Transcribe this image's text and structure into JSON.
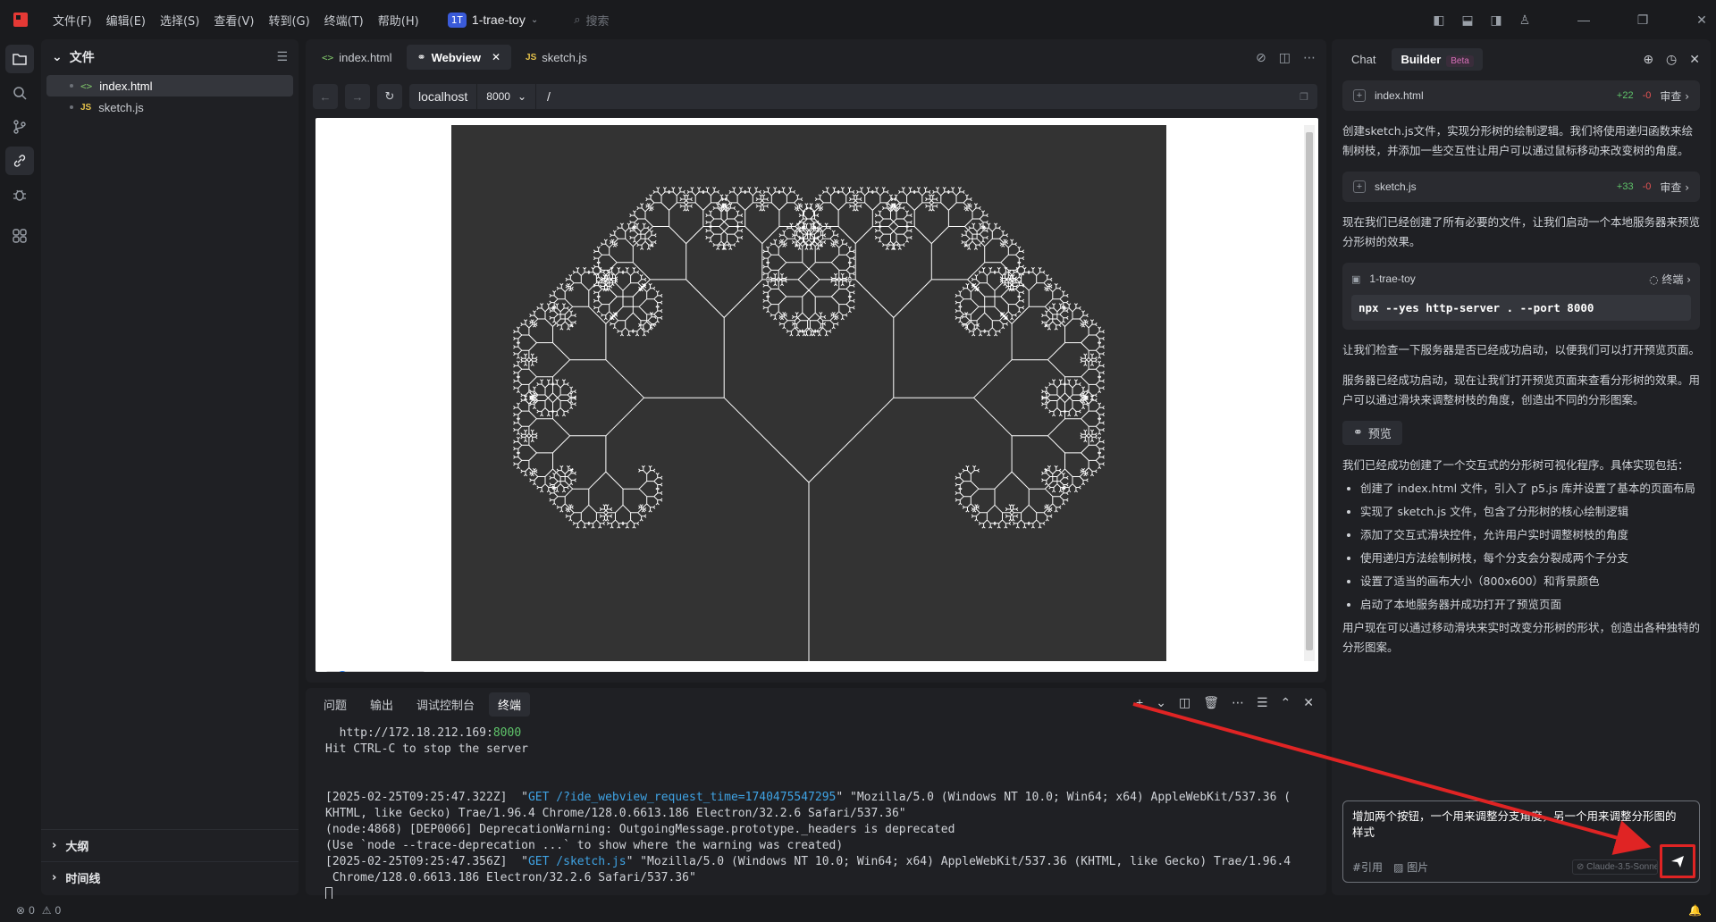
{
  "titlebar": {
    "menu": [
      "文件(F)",
      "编辑(E)",
      "选择(S)",
      "查看(V)",
      "转到(G)",
      "终端(T)",
      "帮助(H)"
    ],
    "project_badge": "1T",
    "project_name": "1-trae-toy",
    "search_placeholder": "搜索"
  },
  "sidebar": {
    "title": "文件",
    "files": [
      {
        "name": "index.html",
        "icon": "html-icon"
      },
      {
        "name": "sketch.js",
        "icon": "js-icon"
      }
    ],
    "outline": "大纲",
    "timeline": "时间线"
  },
  "editor": {
    "tabs": [
      {
        "label": "index.html",
        "icon": "html-icon"
      },
      {
        "label": "Webview",
        "icon": "link-icon",
        "active": true
      },
      {
        "label": "sketch.js",
        "icon": "js-icon"
      }
    ],
    "url": {
      "host": "localhost",
      "port": "8000",
      "path": "/"
    }
  },
  "panel": {
    "tabs": [
      "问题",
      "输出",
      "调试控制台",
      "终端"
    ],
    "active_tab": "终端",
    "terminal": {
      "l1a": "  http://172.18.212.169:",
      "l1b": "8000",
      "l2": "Hit CTRL-C to stop the server",
      "l3a": "[2025-02-25T09:25:47.322Z]  \"",
      "l3b": "GET /?ide_webview_request_time=1740475547295",
      "l3c": "\" \"Mozilla/5.0 (Windows NT 10.0; Win64; x64) AppleWebKit/537.36 (",
      "l4": "KHTML, like Gecko) Trae/1.96.4 Chrome/128.0.6613.186 Electron/32.2.6 Safari/537.36\"",
      "l5": "(node:4868) [DEP0066] DeprecationWarning: OutgoingMessage.prototype._headers is deprecated",
      "l6": "(Use `node --trace-deprecation ...` to show where the warning was created)",
      "l7a": "[2025-02-25T09:25:47.356Z]  \"",
      "l7b": "GET /sketch.js",
      "l7c": "\" \"Mozilla/5.0 (Windows NT 10.0; Win64; x64) AppleWebKit/537.36 (KHTML, like Gecko) Trae/1.96.4",
      "l8": " Chrome/128.0.6613.186 Electron/32.2.6 Safari/537.36\""
    }
  },
  "chat": {
    "tabs": {
      "chat": "Chat",
      "builder": "Builder",
      "beta": "Beta"
    },
    "card1": {
      "file": "index.html",
      "plus": "+22",
      "minus": "-0",
      "review": "审查"
    },
    "msg1": "创建sketch.js文件，实现分形树的绘制逻辑。我们将使用递归函数来绘制树枝，并添加一些交互性让用户可以通过鼠标移动来改变树的角度。",
    "card2": {
      "file": "sketch.js",
      "plus": "+33",
      "minus": "-0",
      "review": "审查"
    },
    "msg2": "现在我们已经创建了所有必要的文件，让我们启动一个本地服务器来预览分形树的效果。",
    "term_card": {
      "name": "1-trae-toy",
      "label": "终端",
      "command": "npx --yes http-server . --port 8000"
    },
    "msg3": "让我们检查一下服务器是否已经成功启动，以便我们可以打开预览页面。",
    "msg4": "服务器已经成功启动，现在让我们打开预览页面来查看分形树的效果。用户可以通过滑块来调整树枝的角度，创造出不同的分形图案。",
    "preview_btn": "预览",
    "msg5": "我们已经成功创建了一个交互式的分形树可视化程序。具体实现包括：",
    "bullets": [
      "创建了 index.html 文件，引入了 p5.js 库并设置了基本的页面布局",
      "实现了 sketch.js 文件，包含了分形树的核心绘制逻辑",
      "添加了交互式滑块控件，允许用户实时调整树枝的角度",
      "使用递归方法绘制树枝，每个分支会分裂成两个子分支",
      "设置了适当的画布大小（800x600）和背景颜色",
      "启动了本地服务器并成功打开了预览页面"
    ],
    "msg6": "用户现在可以通过移动滑块来实时改变分形树的形状，创造出各种独特的分形图案。",
    "composer": {
      "text": "增加两个按钮，一个用来调整分支角度，另一个用来调整分形图的样式",
      "quote": "#引用",
      "image": "图片",
      "model": "Claude-3.5-Sonnet"
    }
  },
  "statusbar": {
    "errors": "0",
    "warnings": "0"
  },
  "colors": {
    "accent": "#3a5bd9",
    "annotation": "#e02424",
    "add": "#5fc46a",
    "remove": "#e55353"
  }
}
